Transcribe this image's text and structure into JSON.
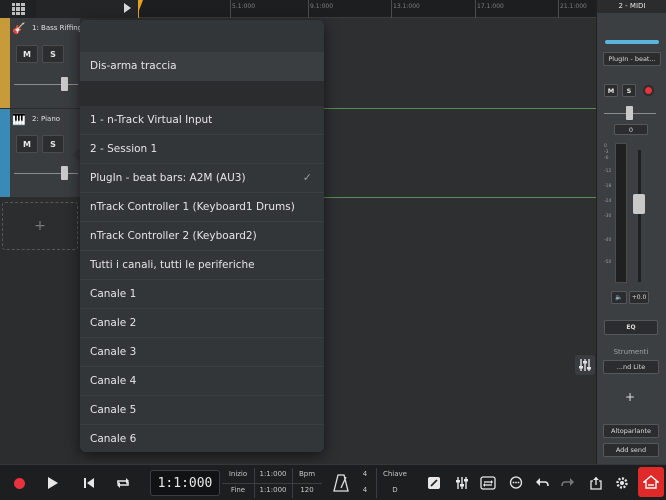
{
  "ruler": {
    "marks": [
      "5.1:000",
      "9.1:000",
      "13.1:000",
      "17.1:000",
      "21.1:000"
    ]
  },
  "tracks": [
    {
      "name": "1: Bass Riffing",
      "icon": "guitar-icon",
      "color": "#c79a3a",
      "mute": "M",
      "solo": "S"
    },
    {
      "name": "2: Piano",
      "icon": "piano-icon",
      "color": "#3a8ab8",
      "mute": "M",
      "solo": "S"
    }
  ],
  "add_track_label": "+",
  "menu": {
    "disarm": "Dis-arma traccia",
    "items": [
      {
        "label": "1 - n-Track Virtual Input",
        "checked": false
      },
      {
        "label": "2 - Session 1",
        "checked": false
      },
      {
        "label": "PlugIn - beat bars: A2M (AU3)",
        "checked": true
      },
      {
        "label": "nTrack Controller 1 (Keyboard1  Drums)",
        "checked": false
      },
      {
        "label": "nTrack Controller 2 (Keyboard2)",
        "checked": false
      },
      {
        "label": "Tutti i canali, tutti le periferiche",
        "checked": false
      },
      {
        "label": "Canale 1",
        "checked": false
      },
      {
        "label": "Canale 2",
        "checked": false
      },
      {
        "label": "Canale 3",
        "checked": false
      },
      {
        "label": "Canale 4",
        "checked": false
      },
      {
        "label": "Canale 5",
        "checked": false
      },
      {
        "label": "Canale 6",
        "checked": false
      }
    ],
    "check_glyph": "✓"
  },
  "inspector": {
    "title": "2 - MIDI",
    "input_label": "PlugIn - beat...",
    "mute": "M",
    "solo": "S",
    "pan_value": "0",
    "db_scale": [
      "0",
      "-3",
      "-6",
      "-12",
      "-18",
      "-24",
      "-30",
      "-40",
      "-50"
    ],
    "gain_value": "+0.0",
    "eq_label": "EQ",
    "instruments_label": "Strumenti",
    "instrument_value": "...nd Lite",
    "add_label": "+",
    "output_label": "Altoparlante",
    "add_send_label": "Add send",
    "accent_color": "#5ab4dc"
  },
  "transport": {
    "counter": "1:1:000",
    "start_label": "Inizio",
    "start_value": "1:1:000",
    "end_label": "Fine",
    "end_value": "1:1:000",
    "bpm_label": "Bpm",
    "bpm_value": "120",
    "sig_top": "4",
    "sig_bottom": "4",
    "key_label": "Chiave",
    "key_value": "D",
    "record_color": "#e8323c"
  }
}
